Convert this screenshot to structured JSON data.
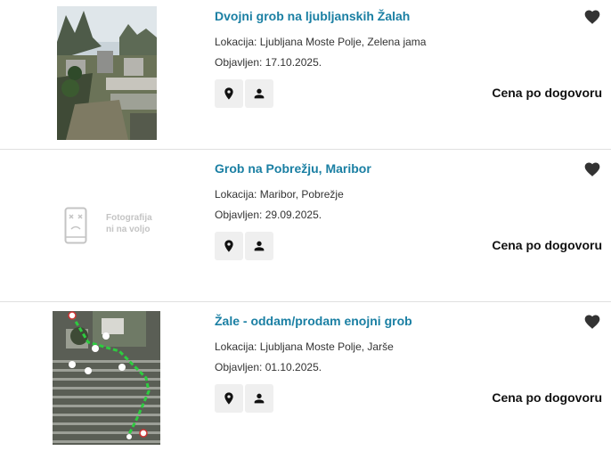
{
  "listings": [
    {
      "title": "Dvojni grob na ljubljanskih Žalah",
      "location": "Lokacija: Ljubljana Moste Polje, Zelena jama",
      "published": "Objavljen: 17.10.2025.",
      "price": "Cena po dogovoru",
      "image": "photo"
    },
    {
      "title": "Grob na Pobrežju, Maribor",
      "location": "Lokacija: Maribor, Pobrežje",
      "published": "Objavljen: 29.09.2025.",
      "price": "Cena po dogovoru",
      "image": "placeholder",
      "placeholder_line1": "Fotografija",
      "placeholder_line2": "ni na voljo"
    },
    {
      "title": "Žale - oddam/prodam enojni grob",
      "location": "Lokacija: Ljubljana Moste Polje, Jarše",
      "published": "Objavljen: 01.10.2025.",
      "price": "Cena po dogovoru",
      "image": "map"
    }
  ],
  "icons": {
    "location": "map-pin-icon",
    "seller": "person-icon",
    "favorite": "heart-icon"
  },
  "colors": {
    "title": "#1a7fa3",
    "route": "#2ecc40"
  }
}
